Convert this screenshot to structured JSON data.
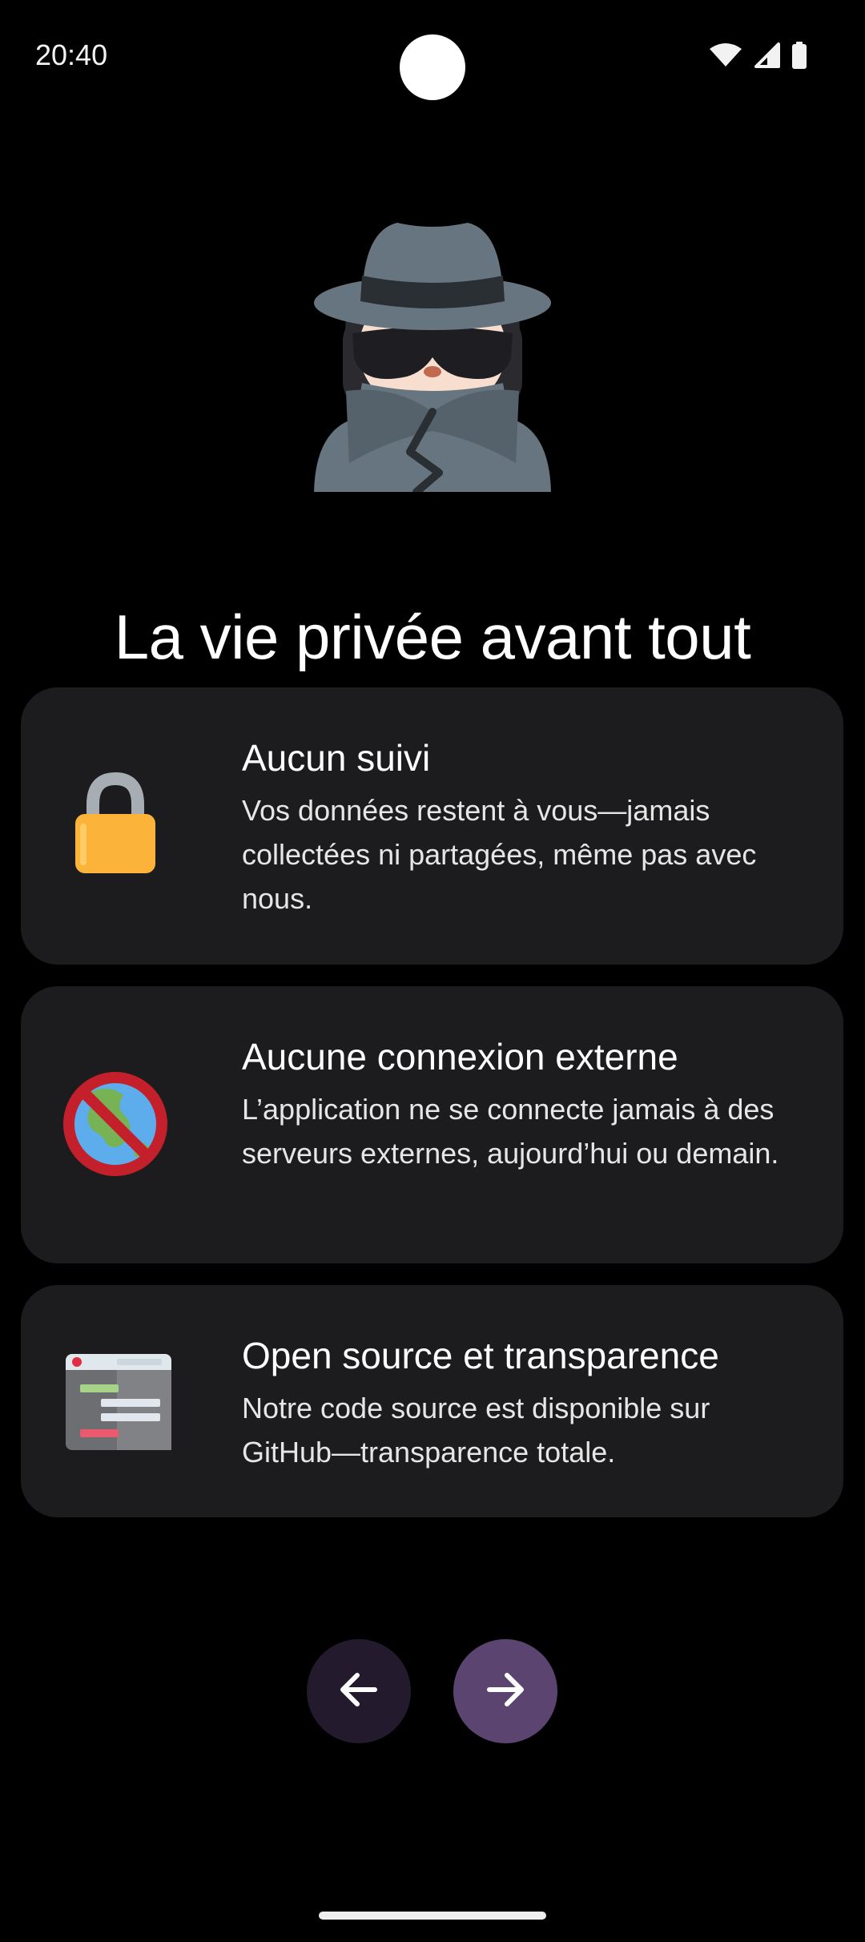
{
  "status_bar": {
    "time": "20:40",
    "icons": [
      "wifi-icon",
      "cellular-signal-icon",
      "battery-icon"
    ]
  },
  "hero": {
    "icon": "detective-emoji-icon"
  },
  "page": {
    "title": "La vie privée avant tout"
  },
  "cards": [
    {
      "icon": "lock-icon",
      "title": "Aucun suivi",
      "description": "Vos données restent à vous—jamais collectées ni partagées, même pas avec nous."
    },
    {
      "icon": "no-globe-icon",
      "title": "Aucune connexion externe",
      "description": "L’application ne se connecte jamais à des serveurs externes, aujourd’hui ou demain."
    },
    {
      "icon": "source-code-window-icon",
      "title": "Open source et transparence",
      "description": "Notre code source est disponible sur GitHub—transparence totale."
    }
  ],
  "navigation": {
    "back_icon": "arrow-left-icon",
    "next_icon": "arrow-right-icon"
  },
  "colors": {
    "background": "#000000",
    "card_background": "#1c1c1e",
    "back_button": "#231a2e",
    "next_button": "#5c4470",
    "lock_gold": "#fbb33a",
    "prohibited_red": "#c4202b"
  }
}
